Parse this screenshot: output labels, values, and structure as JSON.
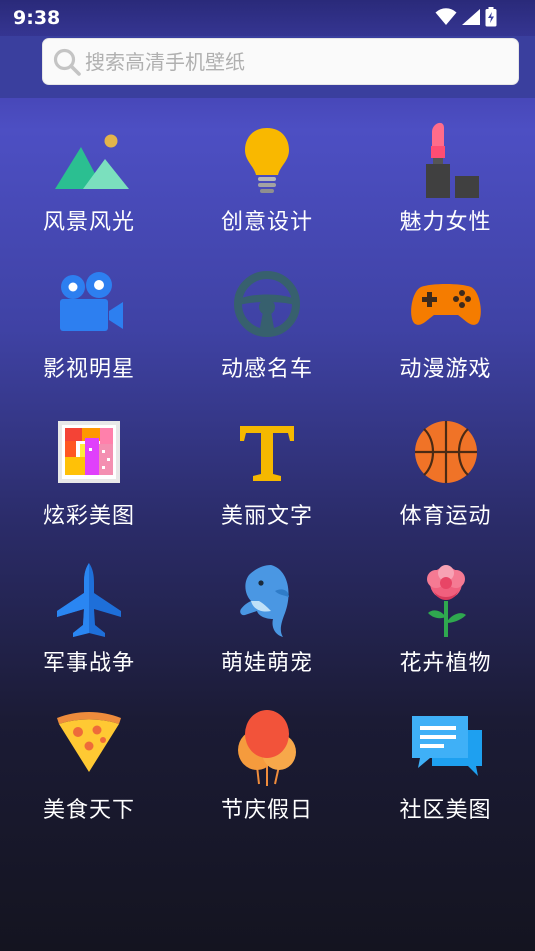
{
  "status_bar": {
    "time": "9:38",
    "icons": [
      "wifi-icon",
      "cellular-signal-icon",
      "battery-charging-icon"
    ]
  },
  "search": {
    "placeholder": "搜索高清手机壁纸",
    "value": ""
  },
  "categories": [
    {
      "label": "风景风光",
      "icon": "landscape-mountains-icon"
    },
    {
      "label": "创意设计",
      "icon": "lightbulb-icon"
    },
    {
      "label": "魅力女性",
      "icon": "lipstick-icon"
    },
    {
      "label": "影视明星",
      "icon": "movie-camera-icon"
    },
    {
      "label": "动感名车",
      "icon": "steering-wheel-icon"
    },
    {
      "label": "动漫游戏",
      "icon": "gamepad-icon"
    },
    {
      "label": "炫彩美图",
      "icon": "colorful-picture-icon"
    },
    {
      "label": "美丽文字",
      "icon": "letter-t-icon"
    },
    {
      "label": "体育运动",
      "icon": "basketball-icon"
    },
    {
      "label": "军事战争",
      "icon": "fighter-jet-icon"
    },
    {
      "label": "萌娃萌宠",
      "icon": "dolphin-icon"
    },
    {
      "label": "花卉植物",
      "icon": "rose-icon"
    },
    {
      "label": "美食天下",
      "icon": "pizza-slice-icon"
    },
    {
      "label": "节庆假日",
      "icon": "balloons-icon"
    },
    {
      "label": "社区美图",
      "icon": "chat-bubbles-icon"
    }
  ],
  "colors": {
    "background_top": "#4d4fc3",
    "background_bottom": "#141420",
    "search_background": "#fafafa",
    "label_text": "#ffffff"
  }
}
